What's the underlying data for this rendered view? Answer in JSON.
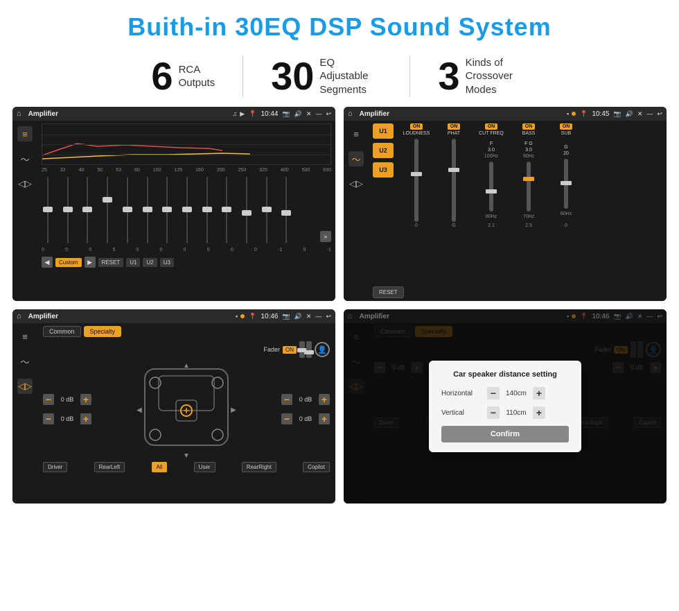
{
  "title": "Buith-in 30EQ DSP Sound System",
  "stats": [
    {
      "number": "6",
      "label": "RCA\nOutputs"
    },
    {
      "number": "30",
      "label": "EQ Adjustable\nSegments"
    },
    {
      "number": "3",
      "label": "Kinds of\nCrossover Modes"
    }
  ],
  "screens": [
    {
      "id": "screen1",
      "topbar": {
        "title": "Amplifier",
        "time": "10:44"
      },
      "type": "eq"
    },
    {
      "id": "screen2",
      "topbar": {
        "title": "Amplifier",
        "time": "10:45"
      },
      "type": "crossover"
    },
    {
      "id": "screen3",
      "topbar": {
        "title": "Amplifier",
        "time": "10:46"
      },
      "type": "fader"
    },
    {
      "id": "screen4",
      "topbar": {
        "title": "Amplifier",
        "time": "10:46"
      },
      "type": "fader-dialog"
    }
  ],
  "eq": {
    "freq_labels": [
      "25",
      "32",
      "40",
      "50",
      "63",
      "80",
      "100",
      "125",
      "160",
      "200",
      "250",
      "320",
      "400",
      "500",
      "630"
    ],
    "values": [
      "0",
      "0",
      "0",
      "5",
      "0",
      "0",
      "0",
      "0",
      "0",
      "0",
      "-1",
      "0",
      "-1"
    ],
    "buttons": [
      "Custom",
      "RESET",
      "U1",
      "U2",
      "U3"
    ]
  },
  "crossover": {
    "channels": [
      "LOUDNESS",
      "PHAT",
      "CUT FREQ",
      "BASS",
      "SUB"
    ],
    "u_buttons": [
      "U1",
      "U2",
      "U3"
    ],
    "reset_label": "RESET"
  },
  "fader": {
    "tabs": [
      "Common",
      "Specialty"
    ],
    "fader_label": "Fader",
    "on_label": "ON",
    "db_values": [
      "0 dB",
      "0 dB",
      "0 dB",
      "0 dB"
    ],
    "zone_buttons": [
      "Driver",
      "RearLeft",
      "All",
      "User",
      "RearRight",
      "Copilot"
    ]
  },
  "dialog": {
    "title": "Car speaker distance setting",
    "horizontal_label": "Horizontal",
    "horizontal_value": "140cm",
    "vertical_label": "Vertical",
    "vertical_value": "110cm",
    "confirm_label": "Confirm"
  }
}
